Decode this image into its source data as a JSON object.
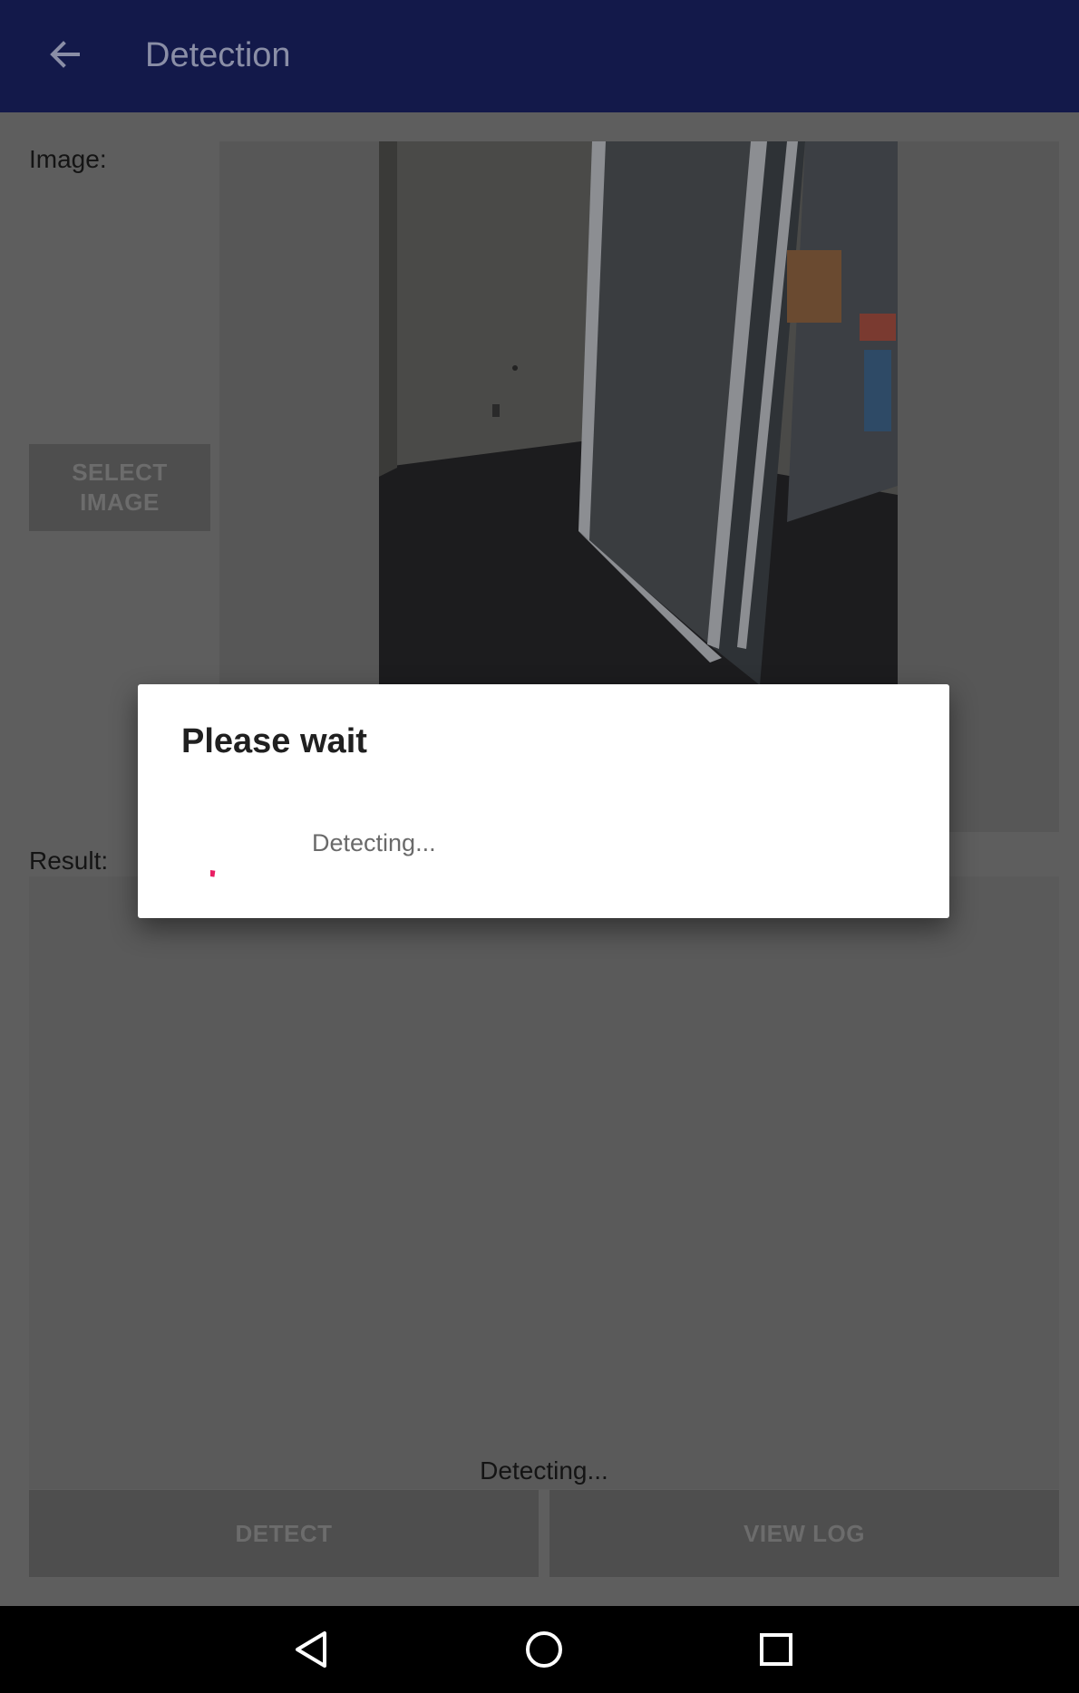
{
  "appbar": {
    "title": "Detection",
    "back_icon": "arrow-left-icon",
    "background": "#13194a"
  },
  "form": {
    "image_label": "Image:",
    "select_button_line1": "SELECT",
    "select_button_line2": "IMAGE",
    "result_label": "Result:",
    "result_text": "Detecting...",
    "detect_button": "DETECT",
    "view_log_button": "VIEW LOG"
  },
  "dialog": {
    "title": "Please wait",
    "message": "Detecting...",
    "spinner_color": "#e91e63"
  },
  "navbar": {
    "back_icon": "triangle-back-icon",
    "home_icon": "circle-home-icon",
    "recents_icon": "square-recents-icon"
  }
}
